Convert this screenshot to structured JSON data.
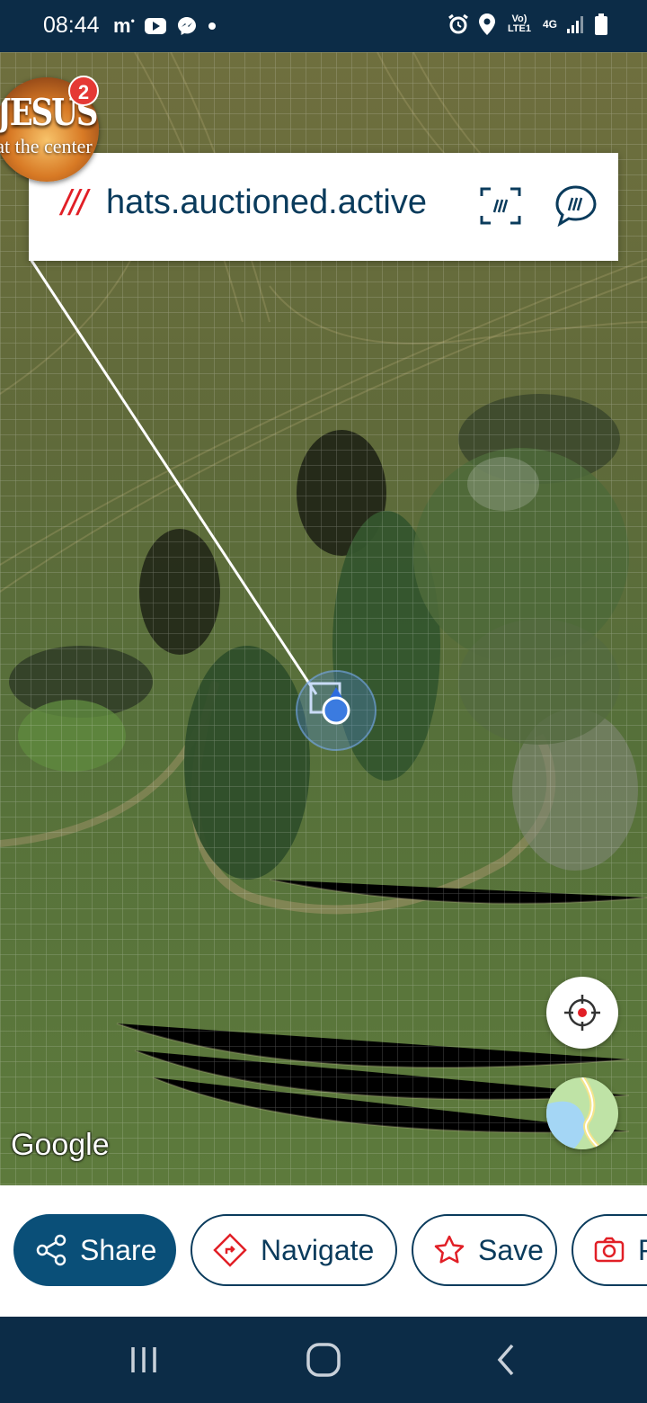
{
  "status_bar": {
    "time": "08:44",
    "left_icons": [
      "m-icon",
      "youtube-icon",
      "messenger-icon",
      "dot-icon"
    ],
    "right_icons": [
      "alarm-icon",
      "location-icon",
      "volte-icon",
      "4g-icon",
      "signal-icon",
      "battery-icon"
    ],
    "volte_label": "Vo) LTE1",
    "network_label": "4G"
  },
  "bubble": {
    "title": "JESUS",
    "subtitle": "at the center",
    "badge_count": "2"
  },
  "address": {
    "slashes": "///",
    "words": "hats.auctioned.active"
  },
  "map": {
    "attribution": "Google"
  },
  "actions": {
    "share": "Share",
    "navigate": "Navigate",
    "save": "Save",
    "photo": "P"
  },
  "colors": {
    "brand_navy": "#0a3b5c",
    "accent_red": "#e11f26",
    "location_blue": "#3b7be0"
  }
}
